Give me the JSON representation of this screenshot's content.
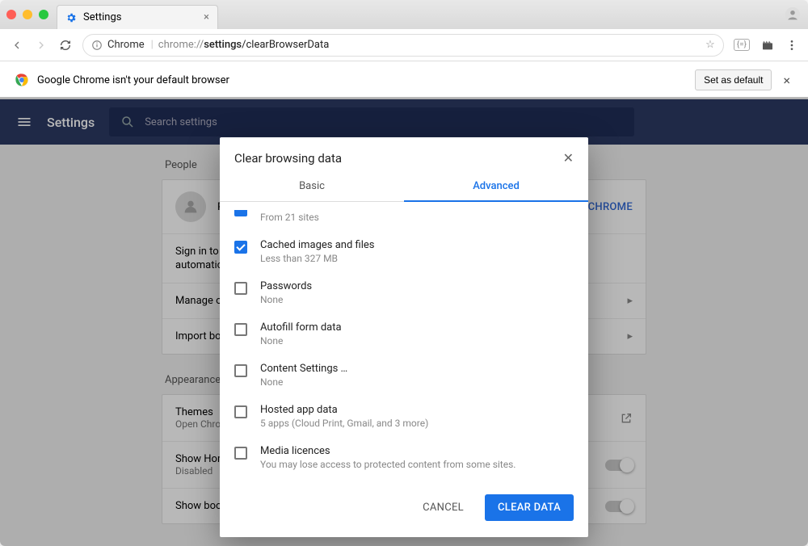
{
  "tab": {
    "title": "Settings"
  },
  "url": {
    "scheme": "chrome://",
    "information_label": "Chrome",
    "host": "settings",
    "path": "/clearBrowserData"
  },
  "infobar": {
    "message": "Google Chrome isn't your default browser",
    "button": "Set as default"
  },
  "header": {
    "title": "Settings",
    "search_placeholder": "Search settings"
  },
  "sections": {
    "people": {
      "label": "People",
      "signin_line1": "Sign in to g",
      "signin_line2": "automatica",
      "sync_button_fragment": "O CHROME",
      "row_manage": "Manage ot",
      "row_import": "Import boo"
    },
    "appearance": {
      "label": "Appearance",
      "themes_title": "Themes",
      "themes_sub": "Open Chro",
      "home_title": "Show Hom",
      "home_sub": "Disabled",
      "bookmarks_title": "Show bookmarks bar"
    }
  },
  "dialog": {
    "title": "Clear browsing data",
    "tabs": {
      "basic": "Basic",
      "advanced": "Advanced"
    },
    "items": [
      {
        "title": "",
        "sub": "From 21 sites",
        "checked": true,
        "partial": true
      },
      {
        "title": "Cached images and files",
        "sub": "Less than 327 MB",
        "checked": true
      },
      {
        "title": "Passwords",
        "sub": "None",
        "checked": false
      },
      {
        "title": "Autofill form data",
        "sub": "None",
        "checked": false
      },
      {
        "title": "Content Settings …",
        "sub": "None",
        "checked": false
      },
      {
        "title": "Hosted app data",
        "sub": "5 apps (Cloud Print, Gmail, and 3 more)",
        "checked": false
      },
      {
        "title": "Media licences",
        "sub": "You may lose access to protected content from some sites.",
        "checked": false
      }
    ],
    "cancel": "CANCEL",
    "confirm": "CLEAR DATA"
  }
}
